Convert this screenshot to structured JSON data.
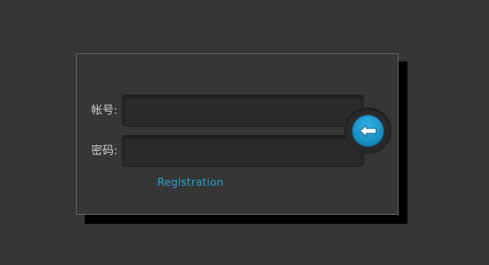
{
  "form": {
    "account_label": "帐号:",
    "password_label": "密码:",
    "account_value": "",
    "password_value": "",
    "registration_link": "Registration",
    "submit_icon": "arrow-left-icon"
  },
  "colors": {
    "background": "#353535",
    "panel": "#363636",
    "accent": "#1a8fc4",
    "link": "#2d9fd0"
  }
}
